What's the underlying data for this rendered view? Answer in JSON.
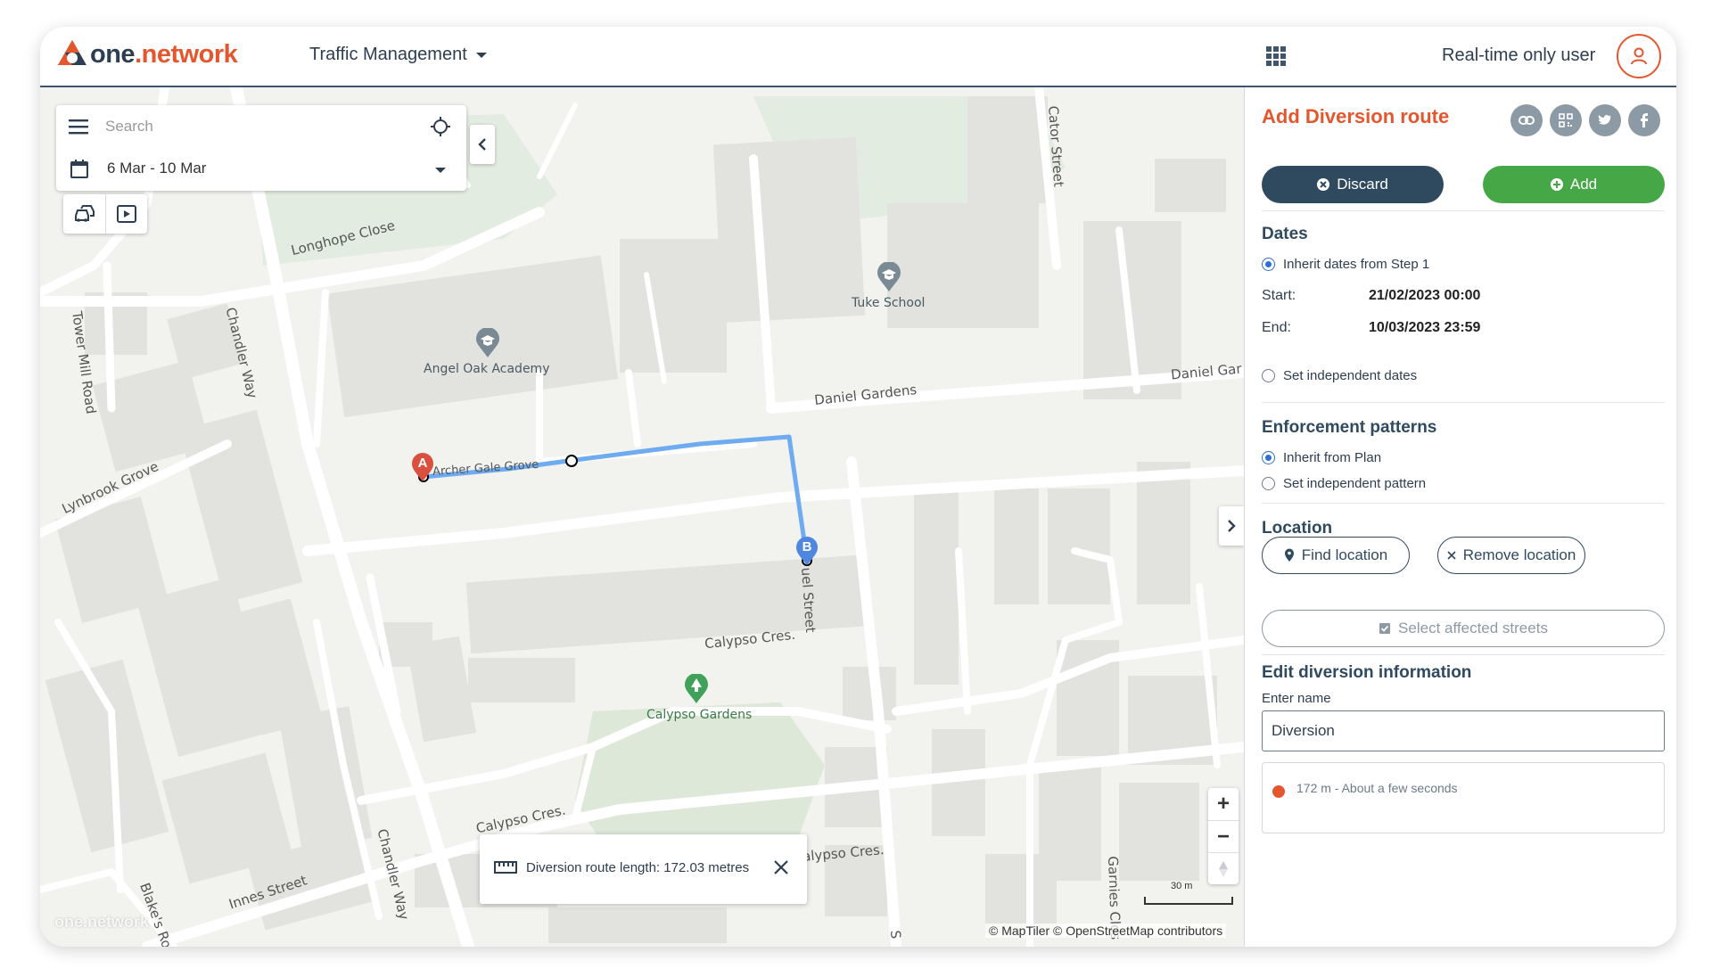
{
  "header": {
    "logo_one": "one",
    "logo_dot": ".",
    "logo_network": "network",
    "app_menu_label": "Traffic Management",
    "user_label": "Real-time only user"
  },
  "map": {
    "search_placeholder": "Search",
    "date_range": "6 Mar - 10 Mar",
    "street_labels": {
      "longhope_close": "Longhope Close",
      "tower_mill_road": "Tower Mill Road",
      "chandler_way_top": "Chandler Way",
      "chandler_way_bottom": "Chandler Way",
      "lynbrook_grove": "Lynbrook Grove",
      "archer_gale_grove": "Archer Gale Grove",
      "daniel_gardens": "Daniel Gardens",
      "daniel_gardens_right": "Daniel Gar",
      "cator_street": "Cator Street",
      "calypso_cres_1": "Calypso Cres.",
      "calypso_cres_2": "Calypso Cres.",
      "calypso_cres_3": "alypso Cres.",
      "innes_street": "Innes Street",
      "blakes_road": "Blake's Ro",
      "garnies_close": "Garnies Clos",
      "duel_street": "uel Street",
      "bottom_s": "S"
    },
    "poi": {
      "tuke_school": "Tuke School",
      "angel_oak_academy": "Angel Oak Academy",
      "calypso_gardens": "Calypso Gardens"
    },
    "marker_a": "A",
    "marker_b": "B",
    "route_length_text": "Diversion route length: 172.03 metres",
    "scale_label": "30 m",
    "attribution": "© MapTiler © OpenStreetMap contributors",
    "watermark": "one.network",
    "route_color": "#6eabf0",
    "marker_a_color": "#d9503f",
    "marker_b_color": "#4e86e0"
  },
  "panel": {
    "title": "Add Diversion route",
    "share_icons": [
      "link-icon",
      "qr-code-icon",
      "twitter-icon",
      "facebook-icon"
    ],
    "discard_label": "Discard",
    "add_label": "Add",
    "dates": {
      "title": "Dates",
      "inherit_label": "Inherit dates from Step 1",
      "start_label": "Start:",
      "start_value": "21/02/2023 00:00",
      "end_label": "End:",
      "end_value": "10/03/2023 23:59",
      "independent_label": "Set independent dates"
    },
    "enforcement": {
      "title": "Enforcement patterns",
      "inherit_label": "Inherit from Plan",
      "independent_label": "Set independent pattern"
    },
    "location": {
      "title": "Location",
      "find_label": "Find location",
      "remove_label": "Remove location",
      "select_streets_label": "Select affected streets"
    },
    "edit_info": {
      "title": "Edit diversion information",
      "name_label": "Enter name",
      "name_value": "Diversion",
      "summary_text": "172 m - About a few seconds"
    },
    "accent_color": "#e4572e",
    "primary_color": "#2f4a5f",
    "add_color": "#45a745"
  }
}
